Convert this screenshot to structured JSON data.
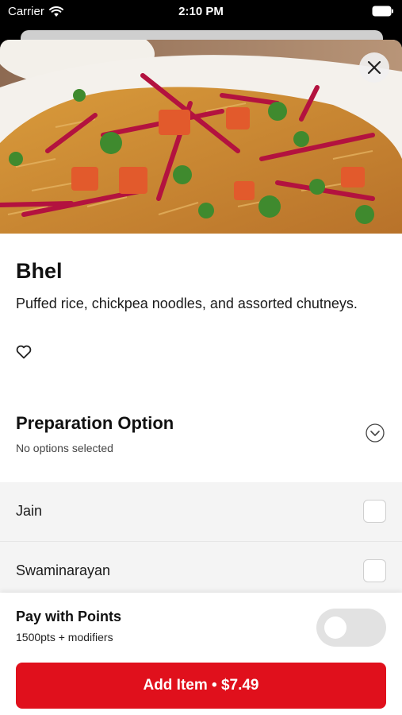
{
  "status_bar": {
    "carrier": "Carrier",
    "time": "2:10 PM"
  },
  "item": {
    "name": "Bhel",
    "description": "Puffed rice, chickpea noodles, and assorted chutneys."
  },
  "preparation": {
    "title": "Preparation Option",
    "subtitle": "No options selected",
    "options": [
      {
        "label": "Jain",
        "checked": false
      },
      {
        "label": "Swaminarayan",
        "checked": false
      }
    ]
  },
  "points": {
    "title": "Pay with Points",
    "subtitle": "1500pts + modifiers",
    "enabled": false
  },
  "cta": {
    "label": "Add Item • $7.49"
  },
  "colors": {
    "accent": "#e0101c",
    "toggle_off": "#e2e2e2"
  },
  "icons": {
    "close": "close-icon",
    "favorite": "heart-outline-icon",
    "expand": "chevron-down-circle-icon"
  }
}
